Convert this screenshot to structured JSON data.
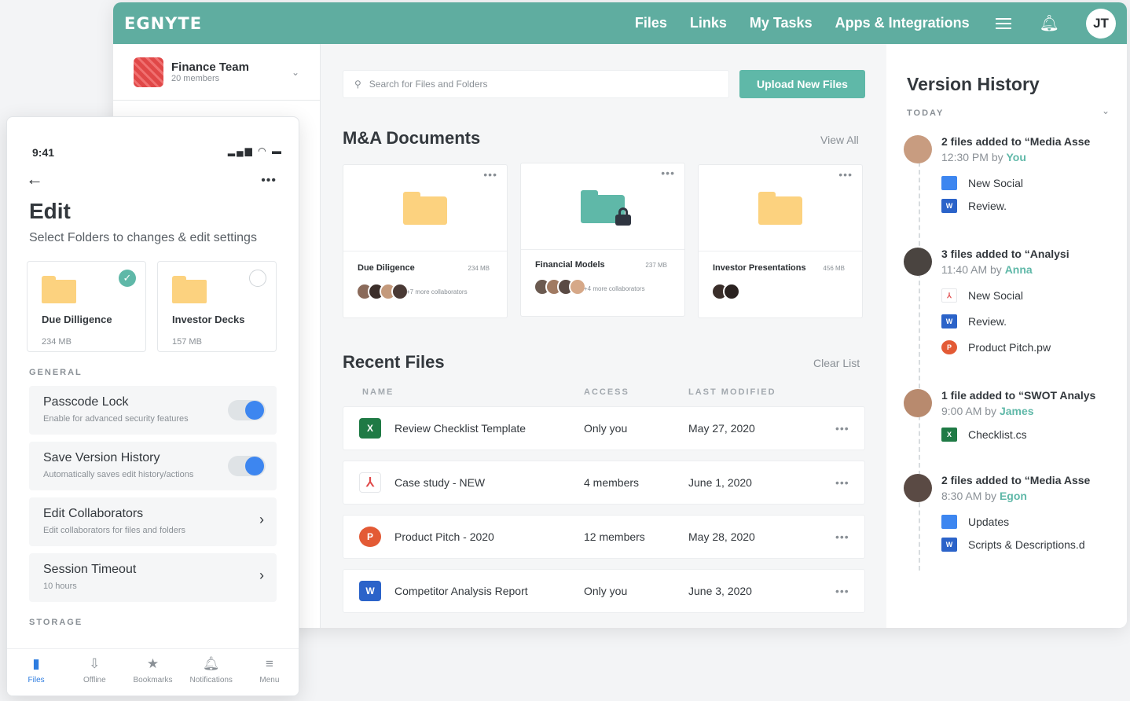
{
  "topbar": {
    "logo": "EGNYTE",
    "nav": [
      "Files",
      "Links",
      "My Tasks",
      "Apps & Integrations"
    ],
    "avatar_initials": "JT"
  },
  "team": {
    "name": "Finance Team",
    "members": "20 members"
  },
  "search": {
    "placeholder": "Search for Files and Folders"
  },
  "upload_label": "Upload New Files",
  "ma": {
    "title": "M&A Documents",
    "view_all": "View All",
    "cards": [
      {
        "name": "Due Diligence",
        "size": "234 MB",
        "collab": "+7 more collaborators",
        "color": "#fcd27f"
      },
      {
        "name": "Financial Models",
        "size": "237 MB",
        "collab": "+4 more collaborators",
        "color": "#5fb8a8",
        "locked": true
      },
      {
        "name": "Investor Presentations",
        "size": "456 MB",
        "collab": "",
        "color": "#fcd27f"
      }
    ]
  },
  "recent": {
    "title": "Recent Files",
    "clear": "Clear List",
    "columns": [
      "NAME",
      "ACCESS",
      "LAST MODIFIED"
    ],
    "rows": [
      {
        "icon": "excel-icon",
        "name": "Review Checklist Template",
        "access": "Only you",
        "modified": "May 27, 2020"
      },
      {
        "icon": "pdf-icon",
        "name": "Case study - NEW",
        "access": "4 members",
        "modified": "June 1, 2020"
      },
      {
        "icon": "powerpoint-icon",
        "name": "Product Pitch - 2020",
        "access": "12 members",
        "modified": "May 28, 2020"
      },
      {
        "icon": "word-icon",
        "name": "Competitor Analysis Report",
        "access": "Only you",
        "modified": "June 3, 2020"
      }
    ]
  },
  "version_history": {
    "title": "Version History",
    "today": "TODAY",
    "entries": [
      {
        "head": "2 files added to “Media Asse",
        "time": "12:30 PM by ",
        "user": "You",
        "files": [
          "New Social",
          "Review."
        ]
      },
      {
        "head": "3 files added to “Analysi",
        "time": "11:40 AM by ",
        "user": "Anna",
        "files": [
          "New Social",
          "Review.",
          "Product Pitch.pw"
        ]
      },
      {
        "head": "1 file added to “SWOT Analys",
        "time": "9:00 AM by ",
        "user": "James",
        "files": [
          "Checklist.cs"
        ]
      },
      {
        "head": "2 files added to “Media Asse",
        "time": "8:30 AM by ",
        "user": "Egon",
        "files": [
          "Updates",
          "Scripts & Descriptions.d"
        ]
      }
    ]
  },
  "phone": {
    "time": "9:41",
    "title": "Edit",
    "subtitle": "Select Folders to changes & edit settings",
    "folders": [
      {
        "name": "Due Dilligence",
        "size": "234 MB",
        "selected": true
      },
      {
        "name": "Investor Decks",
        "size": "157 MB",
        "selected": false
      }
    ],
    "general_label": "GENERAL",
    "settings": [
      {
        "title": "Passcode Lock",
        "sub": "Enable for advanced security features",
        "control": "toggle",
        "on": true
      },
      {
        "title": "Save Version History",
        "sub": "Automatically saves edit history/actions",
        "control": "toggle",
        "on": true
      },
      {
        "title": "Edit Collaborators",
        "sub": "Edit collaborators for files and folders",
        "control": "arrow"
      },
      {
        "title": "Session Timeout",
        "sub": "10 hours",
        "control": "arrow"
      }
    ],
    "storage_label": "STORAGE",
    "tabs": [
      "Files",
      "Offline",
      "Bookmarks",
      "Notifications",
      "Menu"
    ]
  }
}
